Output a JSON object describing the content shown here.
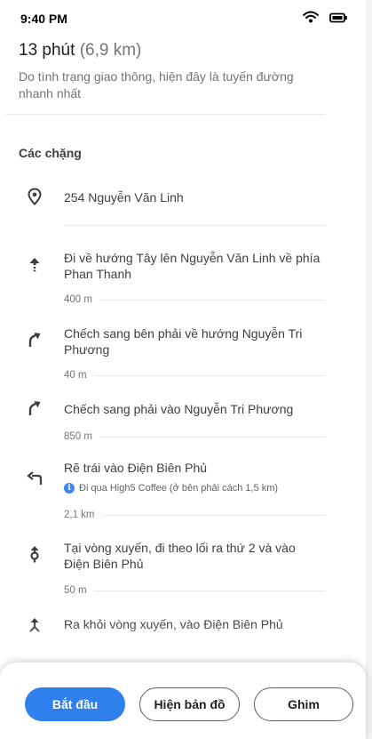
{
  "status_bar": {
    "time": "9:40 PM",
    "icons": [
      "wifi-icon",
      "battery-icon"
    ]
  },
  "summary": {
    "duration": "13 phút",
    "distance": "(6,9 km)",
    "note": "Do tình trạng giao thông, hiện đây là tuyến đường nhanh nhất"
  },
  "steps_section": {
    "title": "Các chặng",
    "start": {
      "icon": "location-pin-icon",
      "address": "254 Nguyễn Văn Linh"
    },
    "steps": [
      {
        "icon": "straight-arrow-icon",
        "text": "Đi về hướng Tây lên Nguyễn Văn Linh về phía Phan Thanh",
        "distance": "400 m"
      },
      {
        "icon": "slight-right-icon",
        "text": "Chếch sang bên phải về hướng Nguyễn Tri Phương",
        "distance": "40 m"
      },
      {
        "icon": "slight-right-icon",
        "text": "Chếch sang phải vào Nguyễn Tri Phương",
        "distance": "850 m"
      },
      {
        "icon": "turn-left-icon",
        "text": "Rẽ trái vào Điện Biên Phủ",
        "note": "Đi qua High5 Coffee (ở bên phải cách 1,5 km)",
        "distance": "2,1 km"
      },
      {
        "icon": "roundabout-icon",
        "text": "Tại vòng xuyến, đi theo lối ra thứ 2 và vào Điện Biên Phủ",
        "distance": "50 m"
      },
      {
        "icon": "roundabout-exit-icon",
        "text": "Ra khỏi vòng xuyến, vào Điện Biên Phủ"
      }
    ]
  },
  "actions": {
    "start_label": "Bắt đầu",
    "map_label": "Hiện bản đồ",
    "pin_label": "Ghim"
  },
  "colors": {
    "primary": "#2f80ed",
    "text": "#3c4043",
    "secondary_text": "#70757a",
    "info": "#4285f4"
  }
}
